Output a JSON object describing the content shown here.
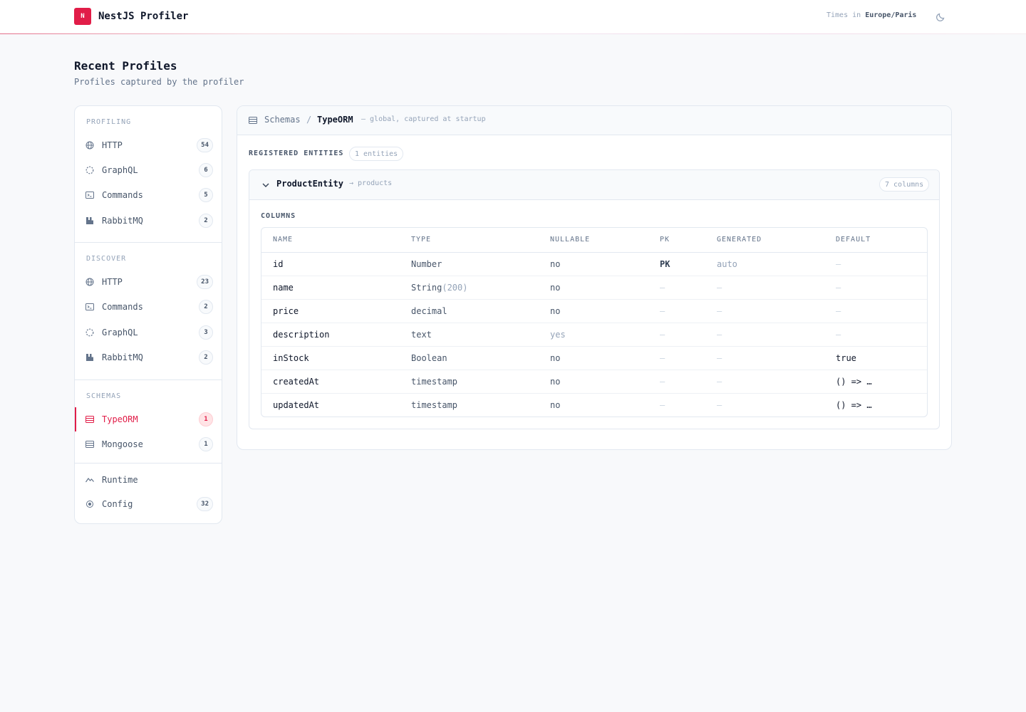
{
  "header": {
    "logo_letter": "N",
    "app_name": "NestJS Profiler",
    "times_in_label": "Times in",
    "timezone": "Europe/Paris",
    "theme_icon": "moon-icon",
    "accent_color": "#e11d48"
  },
  "page": {
    "title": "Recent Profiles",
    "subtitle": "Profiles captured by the profiler"
  },
  "sidebar": {
    "profiling": {
      "title": "PROFILING",
      "items": [
        {
          "label": "HTTP",
          "count": "54",
          "icon": "globe-icon"
        },
        {
          "label": "GraphQL",
          "count": "6",
          "icon": "dashed-circle-icon"
        },
        {
          "label": "Commands",
          "count": "5",
          "icon": "terminal-icon"
        },
        {
          "label": "RabbitMQ",
          "count": "2",
          "icon": "rabbitmq-icon"
        }
      ]
    },
    "discover": {
      "title": "DISCOVER",
      "items": [
        {
          "label": "HTTP",
          "count": "23",
          "icon": "globe-icon"
        },
        {
          "label": "Commands",
          "count": "2",
          "icon": "terminal-icon"
        },
        {
          "label": "GraphQL",
          "count": "3",
          "icon": "dashed-circle-icon"
        },
        {
          "label": "RabbitMQ",
          "count": "2",
          "icon": "rabbitmq-icon"
        }
      ]
    },
    "schemas": {
      "title": "SCHEMAS",
      "items": [
        {
          "label": "TypeORM",
          "count": "1",
          "icon": "table-icon",
          "active": true
        },
        {
          "label": "Mongoose",
          "count": "1",
          "icon": "table-icon"
        }
      ]
    },
    "other": {
      "items": [
        {
          "label": "Runtime",
          "icon": "activity-icon"
        },
        {
          "label": "Config",
          "count": "32",
          "icon": "settings-dot-icon"
        }
      ]
    }
  },
  "main": {
    "breadcrumb": {
      "root": "Schemas",
      "separator": "/",
      "current": "TypeORM",
      "note": "— global, captured at startup"
    },
    "registered_title": "REGISTERED ENTITIES",
    "entities_count": "1 entities",
    "entity": {
      "name": "ProductEntity",
      "table": "→ products",
      "columns_count": "7 columns",
      "columns_title": "COLUMNS",
      "headers": [
        "NAME",
        "TYPE",
        "NULLABLE",
        "PK",
        "GENERATED",
        "DEFAULT"
      ],
      "rows": [
        {
          "name": "id",
          "type": "Number",
          "type_extra": "",
          "nullable": "no",
          "pk": "PK",
          "generated": "auto",
          "default": "—"
        },
        {
          "name": "name",
          "type": "String",
          "type_extra": "(200)",
          "nullable": "no",
          "pk": "—",
          "generated": "—",
          "default": "—"
        },
        {
          "name": "price",
          "type": "decimal",
          "type_extra": "",
          "nullable": "no",
          "pk": "—",
          "generated": "—",
          "default": "—"
        },
        {
          "name": "description",
          "type": "text",
          "type_extra": "",
          "nullable": "yes",
          "pk": "—",
          "generated": "—",
          "default": "—"
        },
        {
          "name": "inStock",
          "type": "Boolean",
          "type_extra": "",
          "nullable": "no",
          "pk": "—",
          "generated": "—",
          "default": "true"
        },
        {
          "name": "createdAt",
          "type": "timestamp",
          "type_extra": "",
          "nullable": "no",
          "pk": "—",
          "generated": "—",
          "default": "() => …"
        },
        {
          "name": "updatedAt",
          "type": "timestamp",
          "type_extra": "",
          "nullable": "no",
          "pk": "—",
          "generated": "—",
          "default": "() => …"
        }
      ]
    }
  }
}
